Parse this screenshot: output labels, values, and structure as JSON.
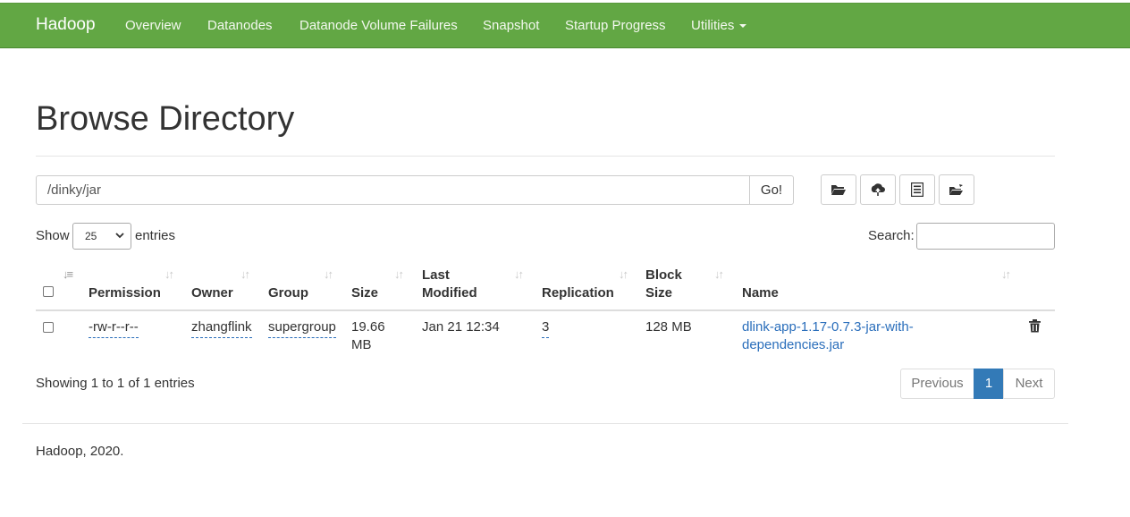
{
  "nav": {
    "brand": "Hadoop",
    "items": [
      "Overview",
      "Datanodes",
      "Datanode Volume Failures",
      "Snapshot",
      "Startup Progress",
      "Utilities"
    ]
  },
  "page": {
    "title": "Browse Directory"
  },
  "path_bar": {
    "value": "/dinky/jar",
    "go_label": "Go!"
  },
  "toolbar_icons": [
    "folder-open-icon",
    "cloud-upload-icon",
    "list-alt-icon",
    "cut-paste-icon"
  ],
  "table_controls": {
    "show_label": "Show",
    "entries_value": "25",
    "entries_label": "entries",
    "search_label": "Search:",
    "search_value": ""
  },
  "table": {
    "headers": {
      "permission": "Permission",
      "owner": "Owner",
      "group": "Group",
      "size": "Size",
      "last_modified_1": "Last",
      "last_modified_2": "Modified",
      "replication": "Replication",
      "block_size_1": "Block",
      "block_size_2": "Size",
      "name": "Name"
    },
    "rows": [
      {
        "permission": "-rw-r--r--",
        "owner": "zhangflink",
        "group": "supergroup",
        "size_1": "19.66",
        "size_2": "MB",
        "last_modified": "Jan 21 12:34",
        "replication": "3",
        "block_size": "128 MB",
        "name_1": "dlink-app-1.17-0.7.3-jar-with-",
        "name_2": "dependencies.jar"
      }
    ]
  },
  "pagination": {
    "info": "Showing 1 to 1 of 1 entries",
    "previous": "Previous",
    "current": "1",
    "next": "Next"
  },
  "footer": {
    "text": "Hadoop, 2020."
  },
  "colors": {
    "navbar": "#62a744",
    "link": "#2a6ebb",
    "active_page": "#337ab7"
  }
}
